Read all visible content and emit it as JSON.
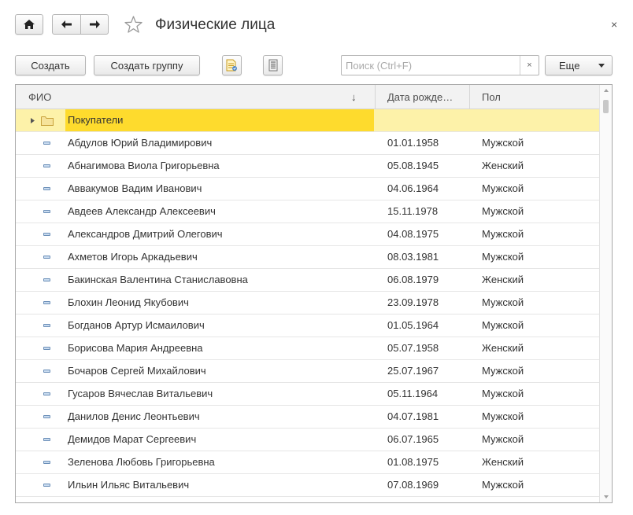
{
  "window": {
    "title": "Физические лица",
    "close_symbol": "×"
  },
  "toolbar": {
    "create_label": "Создать",
    "create_group_label": "Создать группу",
    "search_placeholder": "Поиск (Ctrl+F)",
    "search_value": "",
    "search_clear": "×",
    "more_label": "Еще"
  },
  "icons": {
    "home": "home-icon",
    "back": "arrow-left-icon",
    "forward": "arrow-right-icon",
    "favorite": "star-icon",
    "report": "report-icon",
    "list": "list-icon",
    "folder": "folder-icon",
    "element": "element-icon"
  },
  "colors": {
    "folder_row_bg": "#fdf2a9",
    "folder_cell_bg": "#fedb2d",
    "header_bg": "#f2f2f2",
    "row_icon": "#6b8fb8"
  },
  "table": {
    "columns": {
      "fio": "ФИО",
      "sort_indicator": "↓",
      "birth_date": "Дата рожде…",
      "gender": "Пол"
    },
    "folder_row": {
      "name": "Покупатели",
      "birth_date": "",
      "gender": ""
    },
    "rows": [
      {
        "name": "Абдулов Юрий Владимирович",
        "birth_date": "01.01.1958",
        "gender": "Мужской"
      },
      {
        "name": "Абнагимова Виола Григорьевна",
        "birth_date": "05.08.1945",
        "gender": "Женский"
      },
      {
        "name": "Аввакумов Вадим Иванович",
        "birth_date": "04.06.1964",
        "gender": "Мужской"
      },
      {
        "name": "Авдеев Александр Алексеевич",
        "birth_date": "15.11.1978",
        "gender": "Мужской"
      },
      {
        "name": "Александров Дмитрий Олегович",
        "birth_date": "04.08.1975",
        "gender": "Мужской"
      },
      {
        "name": "Ахметов Игорь Аркадьевич",
        "birth_date": "08.03.1981",
        "gender": "Мужской"
      },
      {
        "name": "Бакинская Валентина Станиславовна",
        "birth_date": "06.08.1979",
        "gender": "Женский"
      },
      {
        "name": "Блохин Леонид Якубович",
        "birth_date": "23.09.1978",
        "gender": "Мужской"
      },
      {
        "name": "Богданов Артур Исмаилович",
        "birth_date": "01.05.1964",
        "gender": "Мужской"
      },
      {
        "name": "Борисова Мария Андреевна",
        "birth_date": "05.07.1958",
        "gender": "Женский"
      },
      {
        "name": "Бочаров Сергей Михайлович",
        "birth_date": "25.07.1967",
        "gender": "Мужской"
      },
      {
        "name": "Гусаров Вячеслав Витальевич",
        "birth_date": "05.11.1964",
        "gender": "Мужской"
      },
      {
        "name": "Данилов Денис Леонтьевич",
        "birth_date": "04.07.1981",
        "gender": "Мужской"
      },
      {
        "name": "Демидов Марат Сергеевич",
        "birth_date": "06.07.1965",
        "gender": "Мужской"
      },
      {
        "name": "Зеленова Любовь Григорьевна",
        "birth_date": "01.08.1975",
        "gender": "Женский"
      },
      {
        "name": "Ильин Ильяс Витальевич",
        "birth_date": "07.08.1969",
        "gender": "Мужской"
      }
    ]
  }
}
